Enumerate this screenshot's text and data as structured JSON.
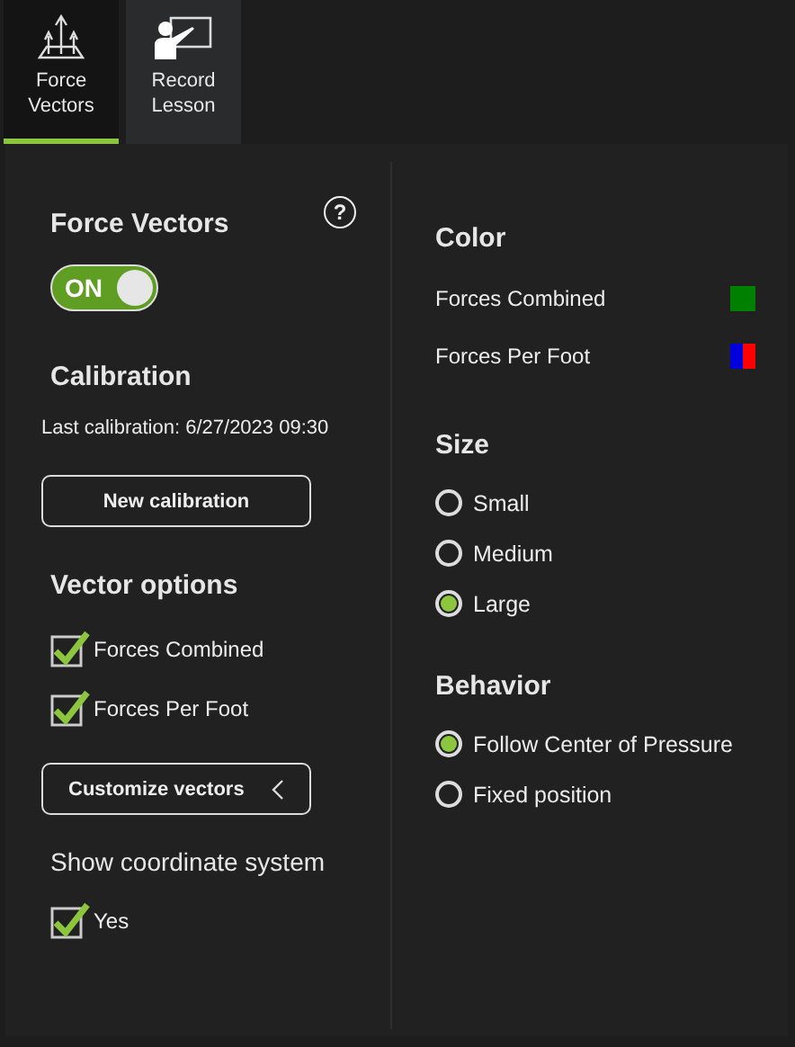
{
  "tabs": [
    {
      "label": "Force Vectors",
      "kind": "vectors",
      "selected": true
    },
    {
      "label": "Record Lesson",
      "kind": "lesson",
      "selected": false
    }
  ],
  "force_vectors": {
    "title": "Force Vectors",
    "help": "?",
    "toggle": {
      "label": "ON",
      "on": true
    }
  },
  "calibration": {
    "title": "Calibration",
    "last": "Last calibration:  6/27/2023 09:30",
    "button": "New calibration"
  },
  "vector_options": {
    "title": "Vector options",
    "items": [
      {
        "label": "Forces Combined",
        "checked": true
      },
      {
        "label": "Forces Per Foot",
        "checked": true
      }
    ],
    "button": "Customize vectors"
  },
  "coordinate_system": {
    "title": "Show coordinate system",
    "items": [
      {
        "label": "Yes",
        "checked": true
      }
    ]
  },
  "color": {
    "title": "Color",
    "items": [
      {
        "label": "Forces Combined",
        "swatches": [
          {
            "color": "#008000"
          }
        ]
      },
      {
        "label": "Forces Per Foot",
        "swatches": [
          {
            "color": "#0000dd"
          },
          {
            "color": "#ff0000"
          }
        ]
      }
    ]
  },
  "size": {
    "title": "Size",
    "options": [
      {
        "label": "Small",
        "selected": false
      },
      {
        "label": "Medium",
        "selected": false
      },
      {
        "label": "Large",
        "selected": true
      }
    ]
  },
  "behavior": {
    "title": "Behavior",
    "options": [
      {
        "label": "Follow Center of Pressure",
        "selected": true
      },
      {
        "label": "Fixed position",
        "selected": false
      }
    ]
  }
}
